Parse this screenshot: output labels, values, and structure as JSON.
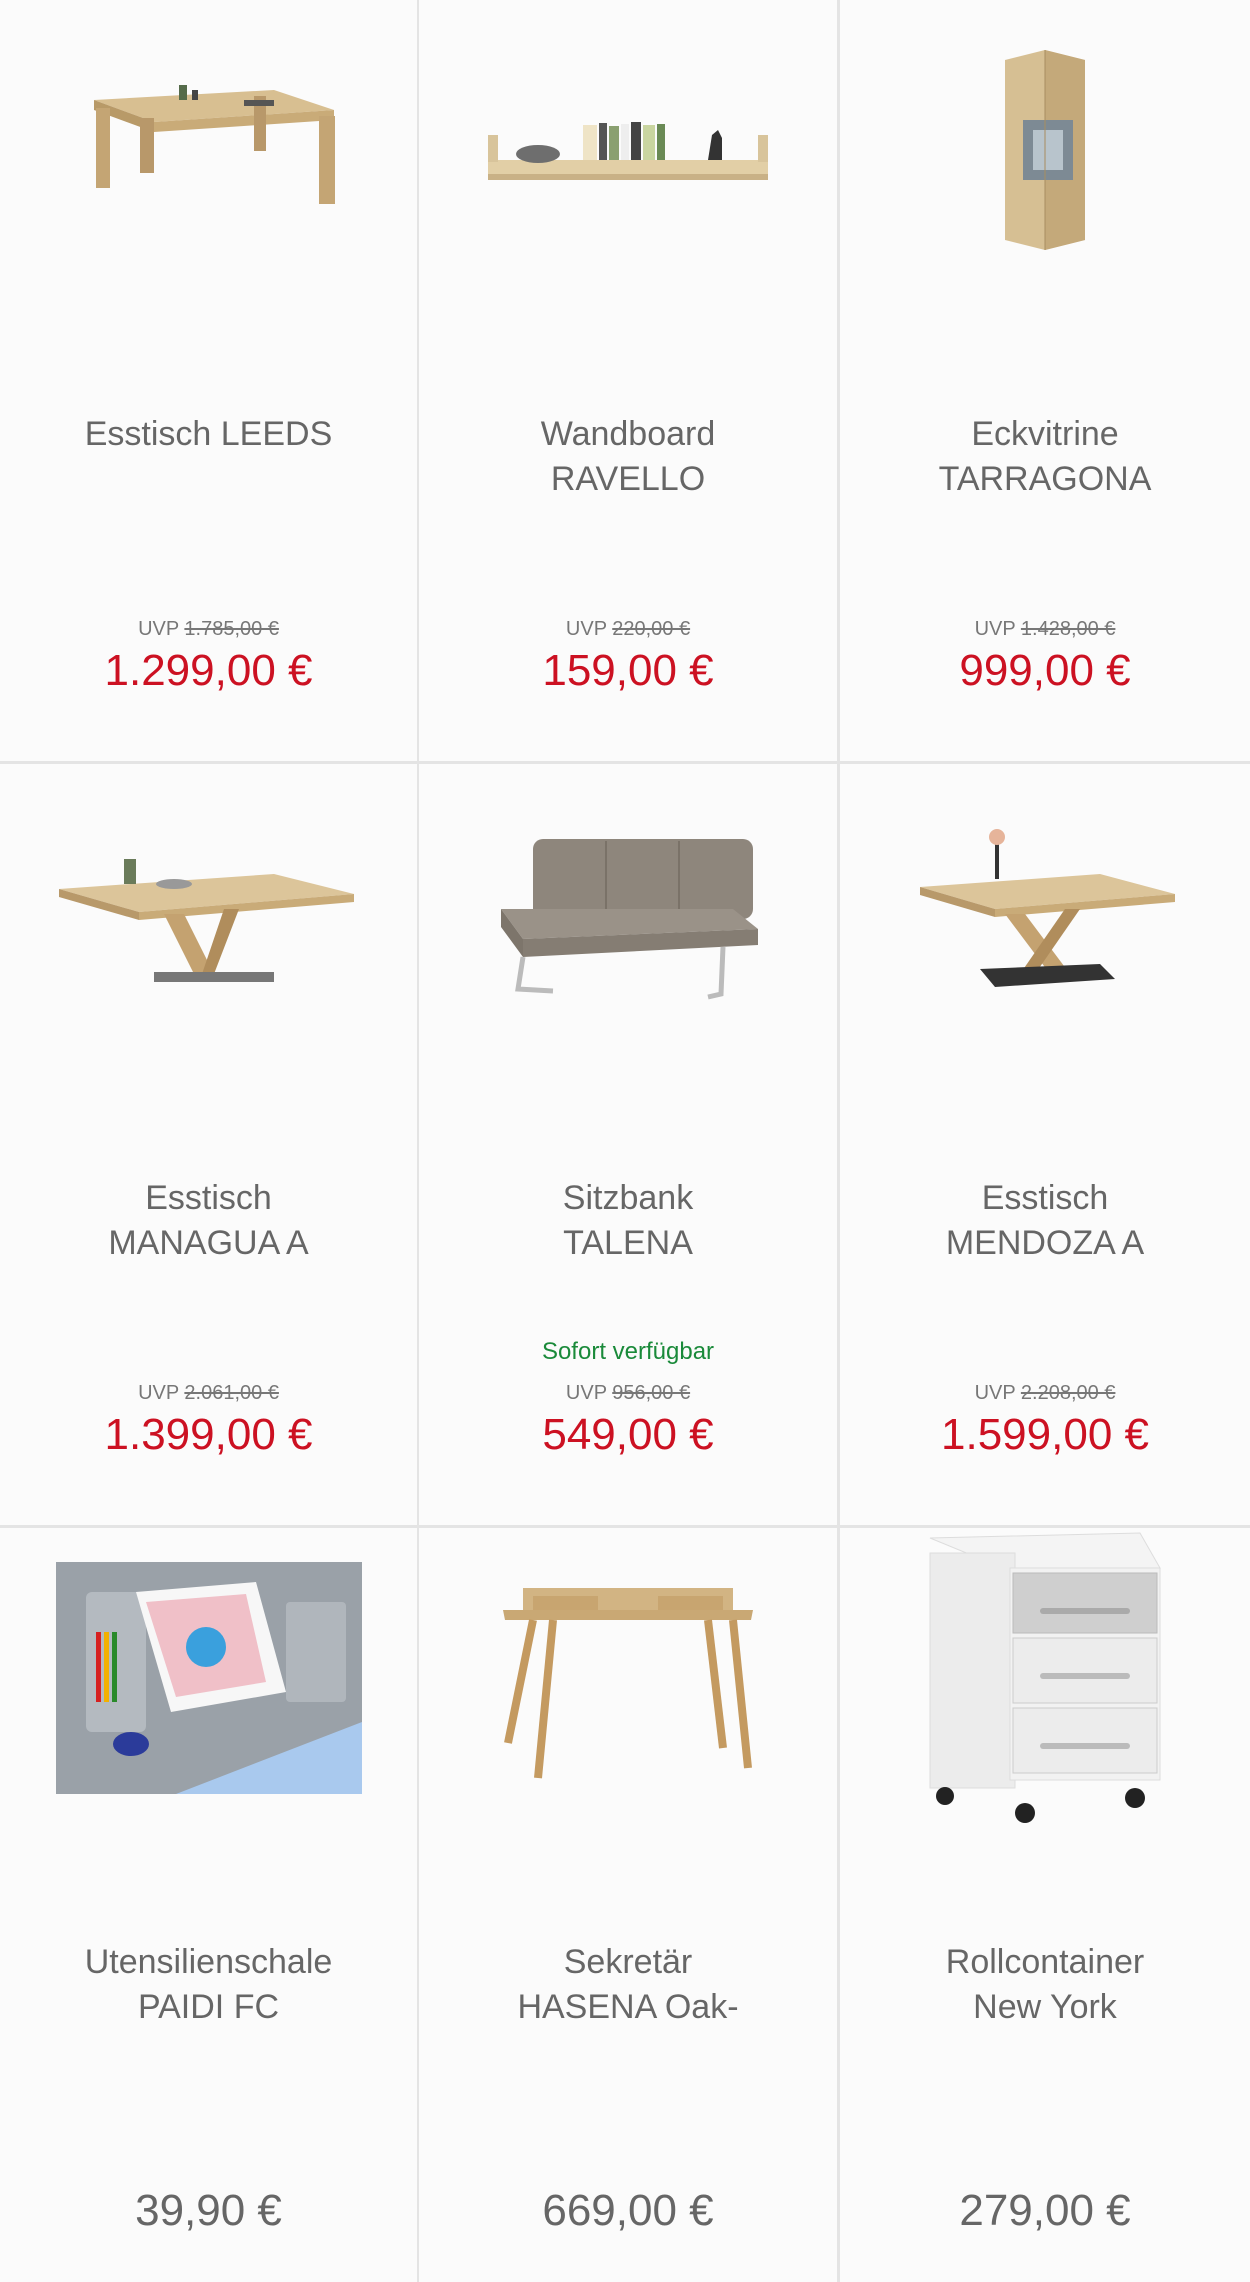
{
  "colors": {
    "sale_price": "#cc1122",
    "regular_price": "#666666",
    "availability": "#1a8a3a",
    "divider": "#e4e4e4"
  },
  "products": [
    {
      "icon": "dining-table-image",
      "name_line1": "Esstisch LEEDS",
      "name_line2": "",
      "availability": "",
      "uvp_label": "UVP",
      "uvp_price": "1.785,00 €",
      "price": "1.299,00 €"
    },
    {
      "icon": "wall-shelf-image",
      "name_line1": "Wandboard",
      "name_line2": "RAVELLO",
      "availability": "",
      "uvp_label": "UVP",
      "uvp_price": "220,00 €",
      "price": "159,00 €"
    },
    {
      "icon": "corner-cabinet-image",
      "name_line1": "Eckvitrine",
      "name_line2": "TARRAGONA",
      "availability": "",
      "uvp_label": "UVP",
      "uvp_price": "1.428,00 €",
      "price": "999,00 €"
    },
    {
      "icon": "extendable-table-image",
      "name_line1": "Esstisch",
      "name_line2": "MANAGUA A",
      "availability": "",
      "uvp_label": "UVP",
      "uvp_price": "2.061,00 €",
      "price": "1.399,00 €"
    },
    {
      "icon": "bench-image",
      "name_line1": "Sitzbank",
      "name_line2": "TALENA",
      "availability": "Sofort verfügbar",
      "uvp_label": "UVP",
      "uvp_price": "956,00 €",
      "price": "549,00 €"
    },
    {
      "icon": "x-base-table-image",
      "name_line1": "Esstisch",
      "name_line2": "MENDOZA A",
      "availability": "",
      "uvp_label": "UVP",
      "uvp_price": "2.208,00 €",
      "price": "1.599,00 €"
    },
    {
      "icon": "utensil-tray-image",
      "name_line1": "Utensilienschale",
      "name_line2": "PAIDI FC",
      "availability": "",
      "uvp_label": "",
      "uvp_price": "",
      "price": "39,90 €"
    },
    {
      "icon": "secretary-desk-image",
      "name_line1": "Sekretär",
      "name_line2": "HASENA Oak-",
      "availability": "",
      "uvp_label": "",
      "uvp_price": "",
      "price": "669,00 €"
    },
    {
      "icon": "rolling-container-image",
      "name_line1": "Rollcontainer",
      "name_line2": "New York",
      "availability": "",
      "uvp_label": "",
      "uvp_price": "",
      "price": "279,00 €"
    }
  ]
}
